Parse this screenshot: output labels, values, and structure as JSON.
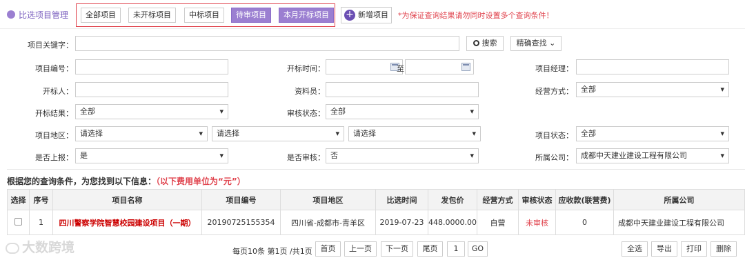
{
  "header": {
    "title": "比选项目管理",
    "filters": [
      "全部项目",
      "未开标项目",
      "中标项目",
      "待审项目",
      "本月开标项目"
    ],
    "add_label": "新增项目",
    "warning": "*为保证查询结果请勿同时设置多个查询条件！"
  },
  "search": {
    "keyword_label": "项目关键字：",
    "keyword_value": "",
    "search_button": "搜索",
    "precise_button": "精确查找"
  },
  "form": {
    "project_no_label": "项目编号：",
    "open_time_label": "开标时间：",
    "to_label": "至",
    "manager_label": "项目经理：",
    "opener_label": "开标人：",
    "clerk_label": "资料员：",
    "mode_label": "经营方式：",
    "mode_value": "全部",
    "result_label": "开标结果：",
    "result_value": "全部",
    "review_label": "审核状态：",
    "review_value": "全部",
    "region_label": "项目地区：",
    "region1": "请选择",
    "region2": "请选择",
    "region3": "请选择",
    "status_label": "项目状态：",
    "status_value": "全部",
    "report_label": "是否上报：",
    "report_value": "是",
    "audit_label": "是否审核：",
    "audit_value": "否",
    "company_label": "所属公司：",
    "company_value": "成都中天建业建设工程有限公司"
  },
  "results": {
    "title": "根据您的查询条件，为您找到以下信息：",
    "note": "（以下费用单位为“元”）",
    "columns": [
      "选择",
      "序号",
      "项目名称",
      "项目编号",
      "项目地区",
      "比选时间",
      "发包价",
      "经营方式",
      "审核状态",
      "应收款(联营费)",
      "所属公司"
    ],
    "rows": [
      {
        "seq": "1",
        "name": "四川警察学院智慧校园建设项目（一期）",
        "code": "20190725155354",
        "region": "四川省-成都市-青羊区",
        "date": "2019-07-23",
        "price": "448.0000.00",
        "mode": "自营",
        "status": "未审核",
        "receivable": "0",
        "company": "成都中天建业建设工程有限公司"
      }
    ]
  },
  "pager": {
    "summary": "每页10条 第1页 /共1页",
    "first": "首页",
    "prev": "上一页",
    "next": "下一页",
    "last": "尾页",
    "page_input": "1",
    "go": "GO",
    "select_all": "全选",
    "export": "导出",
    "print": "打印",
    "delete": "删除"
  },
  "watermark": "大数跨境",
  "colors": {
    "accent": "#9b7fd1",
    "warning": "#e0434d",
    "link_red": "#cc0000"
  }
}
